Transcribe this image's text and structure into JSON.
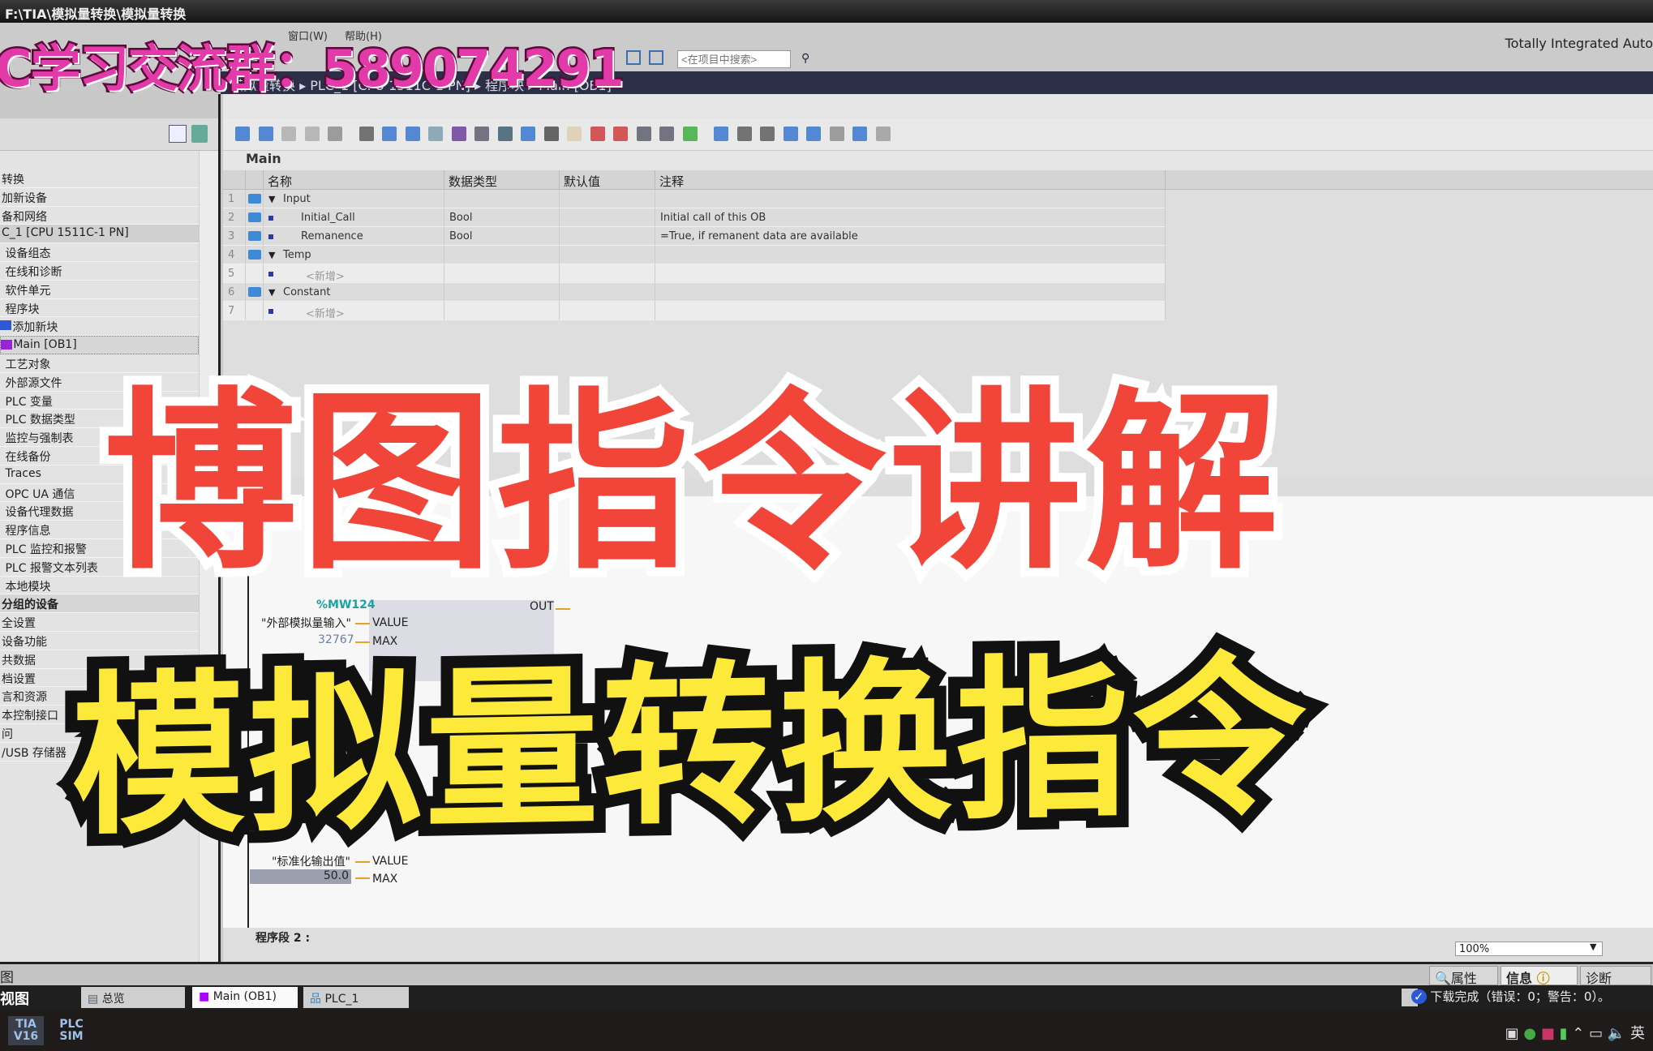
{
  "window": {
    "title": "F:\\TIA\\模拟量转换\\模拟量转换",
    "brand": "Totally Integrated Auto"
  },
  "menu": [
    "窗口(W)",
    "帮助(H)"
  ],
  "search": {
    "placeholder": "<在项目中搜索>"
  },
  "breadcrumb": [
    "模拟量转换",
    "PLC_1 [CPU 1511C-1 PN]",
    "程序块",
    "Main [OB1]"
  ],
  "project_tree": {
    "items": [
      {
        "label": "转换"
      },
      {
        "label": "加新设备"
      },
      {
        "label": "备和网络"
      },
      {
        "label": "C_1 [CPU 1511C-1 PN]",
        "state": "sel"
      },
      {
        "label": " 设备组态"
      },
      {
        "label": " 在线和诊断"
      },
      {
        "label": " 软件单元"
      },
      {
        "label": " 程序块"
      },
      {
        "label": "   添加新块",
        "icon": "add-block-icon"
      },
      {
        "label": "   Main [OB1]",
        "icon": "ob-block-icon",
        "state": "main"
      },
      {
        "label": " 工艺对象"
      },
      {
        "label": " 外部源文件"
      },
      {
        "label": " PLC 变量"
      },
      {
        "label": " PLC 数据类型"
      },
      {
        "label": " 监控与强制表"
      },
      {
        "label": " 在线备份"
      },
      {
        "label": " Traces"
      },
      {
        "label": " OPC UA 通信"
      },
      {
        "label": " 设备代理数据"
      },
      {
        "label": " 程序信息"
      },
      {
        "label": " PLC 监控和报警"
      },
      {
        "label": " PLC 报警文本列表"
      },
      {
        "label": " 本地模块"
      },
      {
        "label": "分组的设备",
        "state": "bold"
      },
      {
        "label": "全设置"
      },
      {
        "label": "设备功能"
      },
      {
        "label": "共数据"
      },
      {
        "label": "档设置"
      },
      {
        "label": "言和资源"
      },
      {
        "label": "本控制接口"
      },
      {
        "label": "问"
      },
      {
        "label": "/USB 存储器"
      }
    ]
  },
  "editor": {
    "block_name": "Main",
    "columns": [
      "名称",
      "数据类型",
      "默认值",
      "注释"
    ],
    "rows": [
      {
        "num": "1",
        "name": "Input",
        "type": "",
        "default": "",
        "comment": "",
        "kind": "section"
      },
      {
        "num": "2",
        "name": "Initial_Call",
        "type": "Bool",
        "default": "",
        "comment": "Initial call of this OB",
        "kind": "var"
      },
      {
        "num": "3",
        "name": "Remanence",
        "type": "Bool",
        "default": "",
        "comment": "=True, if remanent data are available",
        "kind": "var"
      },
      {
        "num": "4",
        "name": "Temp",
        "type": "",
        "default": "",
        "comment": "",
        "kind": "section"
      },
      {
        "num": "5",
        "name": "<新增>",
        "type": "",
        "default": "",
        "comment": "",
        "kind": "add"
      },
      {
        "num": "6",
        "name": "Constant",
        "type": "",
        "default": "",
        "comment": "",
        "kind": "section"
      },
      {
        "num": "7",
        "name": "<新增>",
        "type": "",
        "default": "",
        "comment": "",
        "kind": "add"
      }
    ],
    "network": {
      "norm_x": {
        "address": "%MW124",
        "value_tag": "\"外部模拟量输入\"",
        "value_pin": "VALUE",
        "max_value": "32767",
        "max_pin": "MAX",
        "out_pin": "OUT"
      },
      "scale_x": {
        "value_tag": "\"标准化输出值\"",
        "value_pin": "VALUE",
        "max_value": "50.0",
        "max_pin": "MAX"
      },
      "next_network": "程序段 2 :"
    },
    "zoom": "100%"
  },
  "inspector_tabs": [
    "属性",
    "信息",
    "诊断"
  ],
  "detail_view_label": "图",
  "portal": {
    "label": "视图",
    "tabs": [
      "总览",
      "Main (OB1)",
      "PLC_1"
    ],
    "active": 1,
    "status": "下载完成（错误：0；警告：0）。"
  },
  "taskbar": {
    "apps": [
      "TIA V16",
      "PLC SIM"
    ],
    "ime": "英"
  },
  "toolbar_icons": [
    "insert-network-icon",
    "delete-network-icon",
    "insert-row-icon",
    "add-row-icon",
    "absolute-operand-icon",
    "list-icon",
    "expand-icon",
    "collapse-icon",
    "comment-icon",
    "favorite-icon",
    "box-icon",
    "io-icon",
    "network-icon",
    "bool-icon",
    "star-icon",
    "go-online-icon",
    "go-offline-icon",
    "monitor-icon",
    "snapshot-icon",
    "download-icon",
    "prev-error-icon",
    "indent-icon",
    "outdent-icon",
    "undo-icon",
    "redo-icon",
    "search-icon",
    "glasses-icon",
    "lock-icon"
  ],
  "overlay": {
    "promo": "C学习交流群：589074291",
    "title": "博图指令讲解",
    "subtitle": "模拟量转换指令"
  },
  "colors": {
    "title_red": "#f2453a",
    "subtitle_yellow": "#fde93a",
    "promo_pink": "#e23aa8",
    "breadcrumb_bg": "#2b2f48"
  }
}
